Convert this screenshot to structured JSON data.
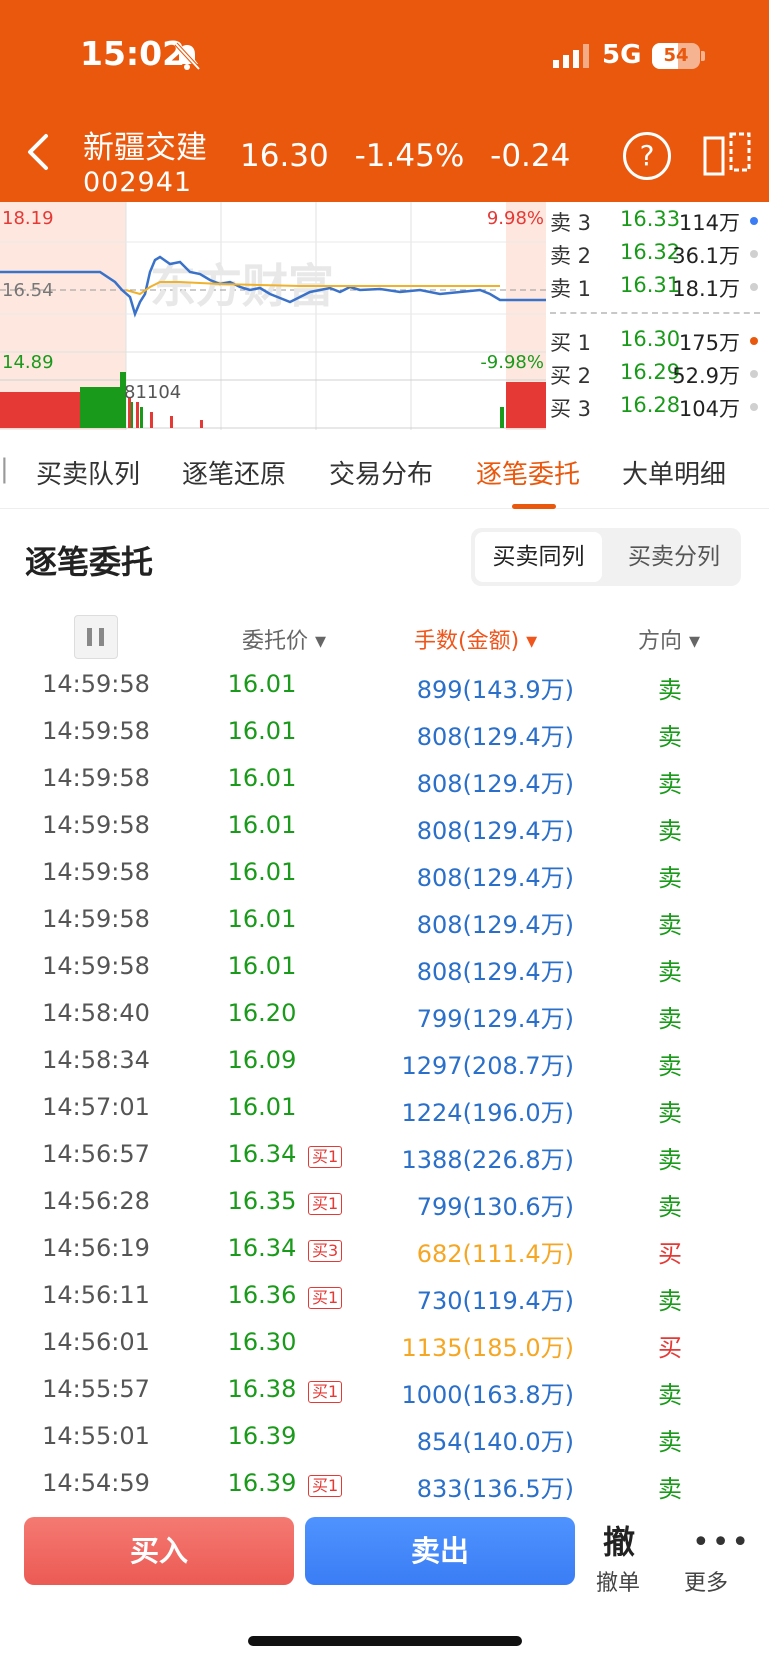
{
  "status_bar": {
    "time": "15:02",
    "network": "5G",
    "battery": "54"
  },
  "header": {
    "name": "新疆交建",
    "code": "002941",
    "price": "16.30",
    "change_pct": "-1.45%",
    "change": "-0.24",
    "help_label": "?"
  },
  "colors": {
    "brand": "#E9580C",
    "up": "#e53935",
    "down": "#1a9a1a",
    "blue": "#2a6fc9",
    "amber": "#f5a623"
  },
  "chart": {
    "max_price": "18.19",
    "min_price": "14.89",
    "pre_close": "16.54",
    "max_pct": "9.98%",
    "min_pct": "-9.98%",
    "volume_label": "81104",
    "watermark": "东方财富"
  },
  "order_book": {
    "asks": [
      {
        "label": "卖 3",
        "price": "16.33",
        "volume": "114万",
        "dot": "#3a7df5"
      },
      {
        "label": "卖 2",
        "price": "16.32",
        "volume": "36.1万",
        "dot": "#d0d0d0"
      },
      {
        "label": "卖 1",
        "price": "16.31",
        "volume": "18.1万",
        "dot": "#d0d0d0"
      }
    ],
    "bids": [
      {
        "label": "买 1",
        "price": "16.30",
        "volume": "175万",
        "dot": "#E9580C"
      },
      {
        "label": "买 2",
        "price": "16.29",
        "volume": "52.9万",
        "dot": "#d0d0d0"
      },
      {
        "label": "买 3",
        "price": "16.28",
        "volume": "104万",
        "dot": "#d0d0d0"
      }
    ]
  },
  "tabs": [
    "买卖队列",
    "逐笔还原",
    "交易分布",
    "逐笔委托",
    "大单明细"
  ],
  "active_tab": "逐笔委托",
  "section": {
    "title": "逐笔委托",
    "seg_same": "买卖同列",
    "seg_split": "买卖分列"
  },
  "columns": {
    "price": "委托价",
    "amount": "手数(金额)",
    "direction": "方向"
  },
  "orders": [
    {
      "time": "14:59:58",
      "price": "16.01",
      "tag": "",
      "amount": "899(143.9万)",
      "dir": "卖"
    },
    {
      "time": "14:59:58",
      "price": "16.01",
      "tag": "",
      "amount": "808(129.4万)",
      "dir": "卖"
    },
    {
      "time": "14:59:58",
      "price": "16.01",
      "tag": "",
      "amount": "808(129.4万)",
      "dir": "卖"
    },
    {
      "time": "14:59:58",
      "price": "16.01",
      "tag": "",
      "amount": "808(129.4万)",
      "dir": "卖"
    },
    {
      "time": "14:59:58",
      "price": "16.01",
      "tag": "",
      "amount": "808(129.4万)",
      "dir": "卖"
    },
    {
      "time": "14:59:58",
      "price": "16.01",
      "tag": "",
      "amount": "808(129.4万)",
      "dir": "卖"
    },
    {
      "time": "14:59:58",
      "price": "16.01",
      "tag": "",
      "amount": "808(129.4万)",
      "dir": "卖"
    },
    {
      "time": "14:58:40",
      "price": "16.20",
      "tag": "",
      "amount": "799(129.4万)",
      "dir": "卖"
    },
    {
      "time": "14:58:34",
      "price": "16.09",
      "tag": "",
      "amount": "1297(208.7万)",
      "dir": "卖"
    },
    {
      "time": "14:57:01",
      "price": "16.01",
      "tag": "",
      "amount": "1224(196.0万)",
      "dir": "卖"
    },
    {
      "time": "14:56:57",
      "price": "16.34",
      "tag": "买1",
      "amount": "1388(226.8万)",
      "dir": "卖"
    },
    {
      "time": "14:56:28",
      "price": "16.35",
      "tag": "买1",
      "amount": "799(130.6万)",
      "dir": "卖"
    },
    {
      "time": "14:56:19",
      "price": "16.34",
      "tag": "买3",
      "amount": "682(111.4万)",
      "dir": "买"
    },
    {
      "time": "14:56:11",
      "price": "16.36",
      "tag": "买1",
      "amount": "730(119.4万)",
      "dir": "卖"
    },
    {
      "time": "14:56:01",
      "price": "16.30",
      "tag": "",
      "amount": "1135(185.0万)",
      "dir": "买"
    },
    {
      "time": "14:55:57",
      "price": "16.38",
      "tag": "买1",
      "amount": "1000(163.8万)",
      "dir": "卖"
    },
    {
      "time": "14:55:01",
      "price": "16.39",
      "tag": "",
      "amount": "854(140.0万)",
      "dir": "卖"
    },
    {
      "time": "14:54:59",
      "price": "16.39",
      "tag": "买1",
      "amount": "833(136.5万)",
      "dir": "卖"
    }
  ],
  "bottom": {
    "buy": "买入",
    "sell": "卖出",
    "cancel_icon": "撤",
    "cancel": "撤单",
    "more_icon": "•••",
    "more": "更多"
  }
}
